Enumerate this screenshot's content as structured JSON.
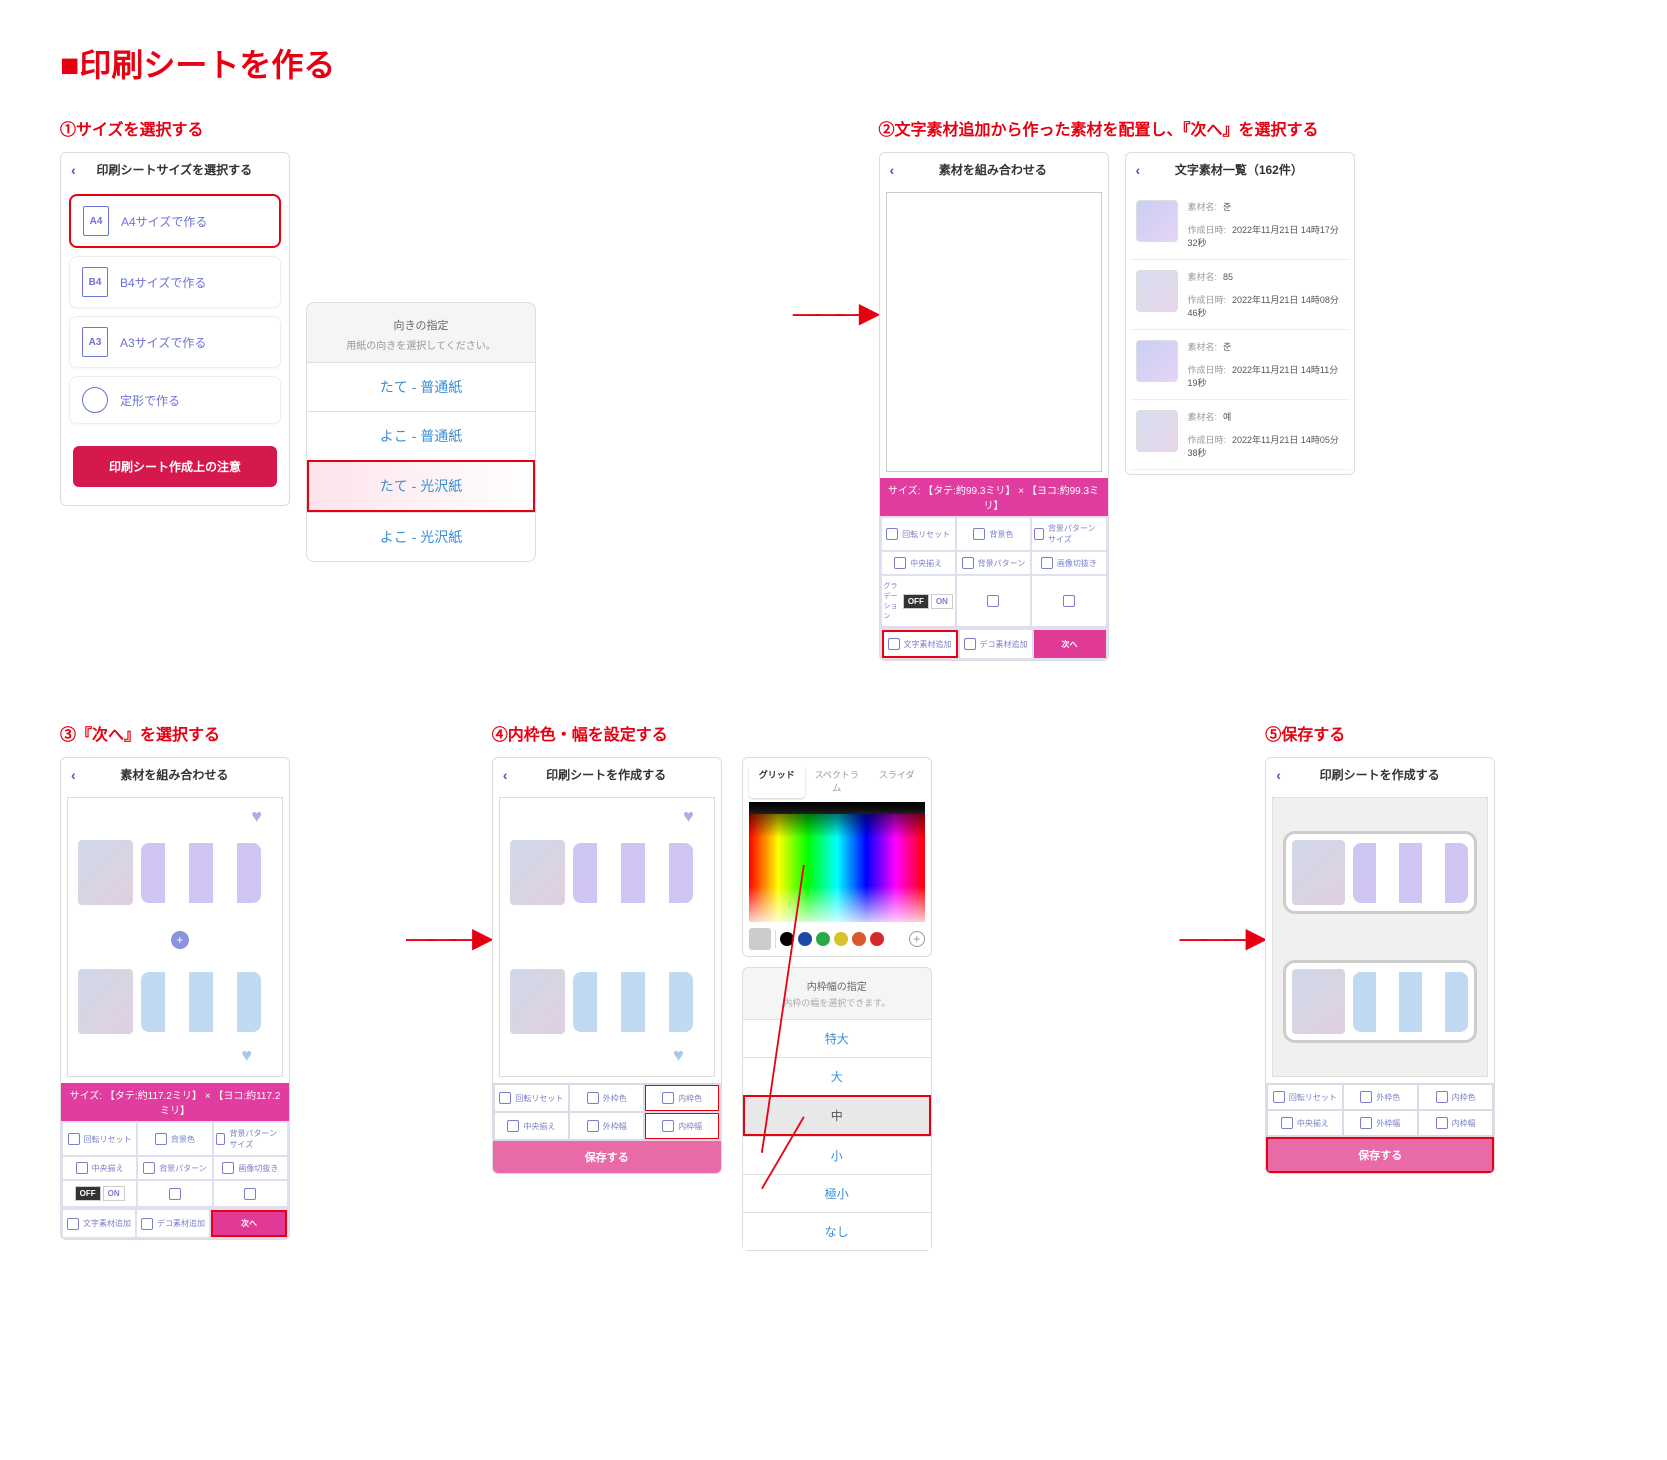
{
  "page_title": "■印刷シートを作る",
  "steps": {
    "s1": {
      "title": "①サイズを選択する"
    },
    "s2": {
      "title": "②文字素材追加から作った素材を配置し、『次へ』を選択する"
    },
    "s3": {
      "title": "③『次へ』を選択する"
    },
    "s4": {
      "title": "④内枠色・幅を設定する"
    },
    "s5": {
      "title": "⑤保存する"
    }
  },
  "size_screen": {
    "header": "印刷シートサイズを選択する",
    "options": [
      {
        "code": "A4",
        "label": "A4サイズで作る"
      },
      {
        "code": "B4",
        "label": "B4サイズで作る"
      },
      {
        "code": "A3",
        "label": "A3サイズで作る"
      },
      {
        "code": "—",
        "label": "定形で作る"
      }
    ],
    "notes_button": "印刷シート作成上の注意"
  },
  "orientation_panel": {
    "title": "向きの指定",
    "subtitle": "用紙の向きを選択してください。",
    "options": [
      "たて - 普通紙",
      "よこ - 普通紙",
      "たて - 光沢紙",
      "よこ - 光沢紙"
    ]
  },
  "compose_screen": {
    "header": "素材を組み合わせる",
    "size_bar": "サイズ: 【タテ:約99.3ミリ】 × 【ヨコ:約99.3ミリ】",
    "tools": [
      "回転リセット",
      "背景色",
      "背景パターンサイズ",
      "中央揃え",
      "背景パターン",
      "画像切抜き"
    ],
    "gradation_label": "グラデーション",
    "toggle_off": "OFF",
    "toggle_on": "ON",
    "bottom": {
      "add_text": "文字素材追加",
      "add_deco": "デコ素材追加",
      "next": "次へ"
    }
  },
  "material_list": {
    "header": "文字素材一覧（162件）",
    "name_label": "素材名:",
    "date_label": "作成日時:",
    "items": [
      {
        "name": "준",
        "date": "2022年11月21日 14時17分32秒"
      },
      {
        "name": "85",
        "date": "2022年11月21日 14時08分46秒"
      },
      {
        "name": "준",
        "date": "2022年11月21日 14時11分19秒"
      },
      {
        "name": "예",
        "date": "2022年11月21日 14時05分38秒"
      }
    ]
  },
  "compose_screen2": {
    "size_bar": "サイズ: 【タテ:約117.2ミリ】 × 【ヨコ:約117.2ミリ】"
  },
  "edit_screen": {
    "header": "印刷シートを作成する",
    "tools": [
      "回転リセット",
      "外枠色",
      "内枠色",
      "中央揃え",
      "外枠幅",
      "内枠幅"
    ],
    "save": "保存する"
  },
  "color_panel": {
    "tabs": [
      "グリッド",
      "スペクトラム",
      "スライダ"
    ],
    "swatches": [
      "#000000",
      "#1a4aa8",
      "#2aa84a",
      "#d6c22a",
      "#d65a2a",
      "#d62a2a"
    ]
  },
  "width_panel": {
    "title": "内枠幅の指定",
    "subtitle": "内枠の幅を選択できます。",
    "options": [
      "特大",
      "大",
      "中",
      "小",
      "極小",
      "なし"
    ]
  }
}
